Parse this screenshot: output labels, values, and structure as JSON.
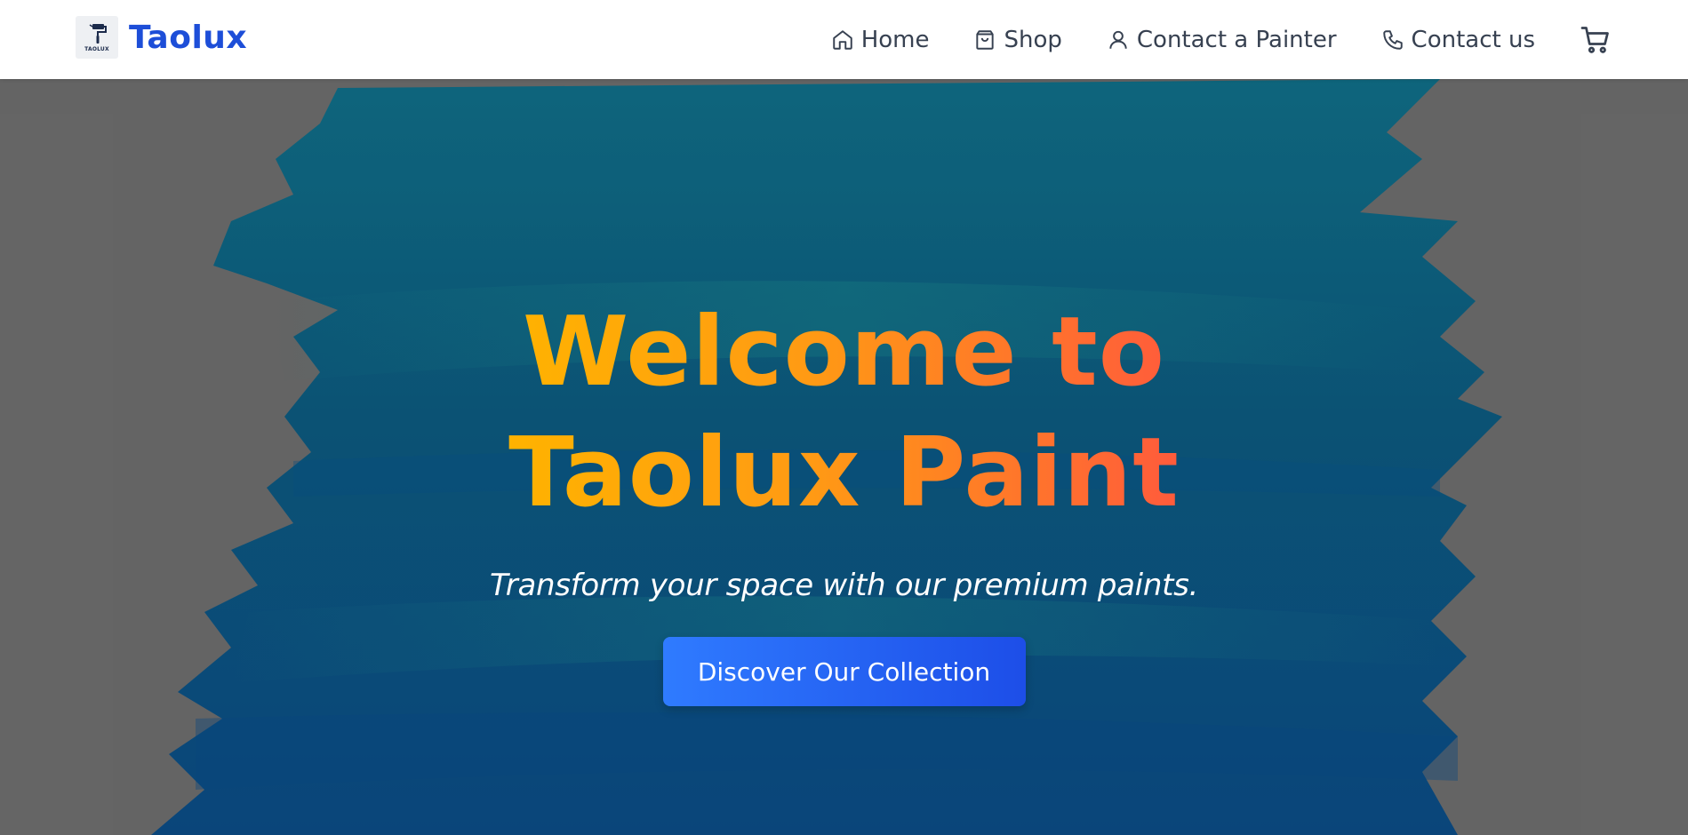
{
  "navbar": {
    "brand_name": "Taolux",
    "brand_logo_text": "TAOLUX",
    "links": [
      {
        "label": "Home",
        "icon": "home-icon"
      },
      {
        "label": "Shop",
        "icon": "shopping-bag-icon"
      },
      {
        "label": "Contact a Painter",
        "icon": "user-icon"
      },
      {
        "label": "Contact us",
        "icon": "phone-icon"
      }
    ],
    "cart_icon": "cart-icon"
  },
  "hero": {
    "title": "Welcome to Taolux Paint",
    "subtitle": "Transform your space with our premium paints.",
    "cta_label": "Discover Our Collection"
  },
  "colors": {
    "brand": "#1d4ed8",
    "nav_text": "#374151",
    "hero_background": "#6b6b6b",
    "paint_stroke": "#0e5c7a",
    "title_gradient_start": "#ffb300",
    "title_gradient_end": "#ff5a3c",
    "button_gradient_start": "#2f7bff",
    "button_gradient_end": "#1d4ee8"
  }
}
